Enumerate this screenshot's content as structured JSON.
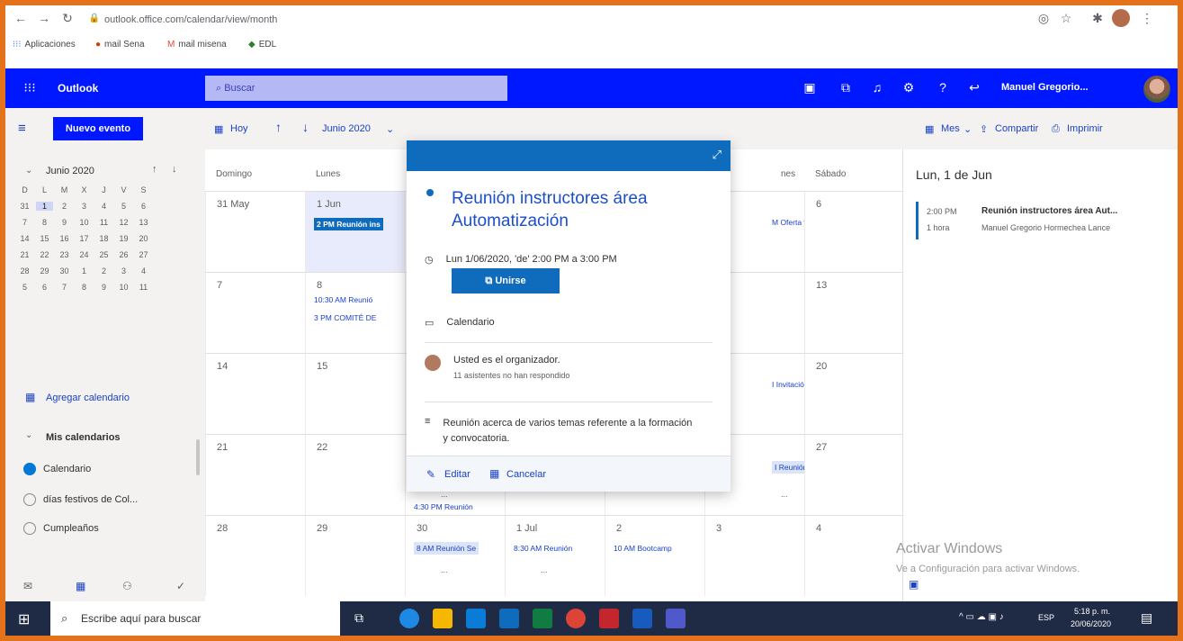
{
  "browser": {
    "url": "outlook.office.com/calendar/view/month",
    "bookmarks": [
      "Aplicaciones",
      "mail Sena",
      "mail misena",
      "EDL"
    ]
  },
  "header": {
    "app_name": "Outlook",
    "search_placeholder": "Buscar",
    "user_name": "Manuel Gregorio..."
  },
  "toolbar": {
    "new_event": "Nuevo evento",
    "today": "Hoy",
    "month_label": "Junio 2020",
    "view": "Mes",
    "share": "Compartir",
    "print": "Imprimir"
  },
  "mini_calendar": {
    "title": "Junio 2020",
    "weekday_headers": [
      "D",
      "L",
      "M",
      "X",
      "J",
      "V",
      "S"
    ],
    "weeks": [
      [
        "31",
        "1",
        "2",
        "3",
        "4",
        "5",
        "6"
      ],
      [
        "7",
        "8",
        "9",
        "10",
        "11",
        "12",
        "13"
      ],
      [
        "14",
        "15",
        "16",
        "17",
        "18",
        "19",
        "20"
      ],
      [
        "21",
        "22",
        "23",
        "24",
        "25",
        "26",
        "27"
      ],
      [
        "28",
        "29",
        "30",
        "1",
        "2",
        "3",
        "4"
      ],
      [
        "5",
        "6",
        "7",
        "8",
        "9",
        "10",
        "11"
      ]
    ],
    "selected": "1"
  },
  "left_nav": {
    "add_calendar": "Agregar calendario",
    "my_calendars": "Mis calendarios",
    "calendars": [
      {
        "name": "Calendario",
        "checked": true
      },
      {
        "name": "días festivos de Col...",
        "checked": false
      },
      {
        "name": "Cumpleaños",
        "checked": false
      }
    ]
  },
  "grid": {
    "day_headers": [
      "Domingo",
      "Lunes",
      "",
      "",
      "",
      "nes",
      "Sábado"
    ],
    "weeks": [
      {
        "days": [
          "31 May",
          "1 Jun",
          "",
          "",
          "",
          "",
          "6"
        ]
      },
      {
        "days": [
          "7",
          "8",
          "",
          "",
          "",
          "",
          "13"
        ]
      },
      {
        "days": [
          "14",
          "15",
          "",
          "",
          "",
          "",
          "20"
        ]
      },
      {
        "days": [
          "21",
          "22",
          "",
          "",
          "",
          "",
          "27"
        ]
      },
      {
        "days": [
          "28",
          "29",
          "30",
          "1 Jul",
          "2",
          "3",
          "4"
        ]
      }
    ],
    "events": {
      "mon1": "2 PM Reunión ins",
      "fri1": "M Oferta y c",
      "mon8a": "10:30 AM Reunió",
      "mon8b": "3 PM COMITÉ DE",
      "fri15": "I Invitació",
      "fri22": "I Reunión",
      "wed24": "4:30 PM Reunión",
      "tue30": "8 AM Reunión Se",
      "wed1": "8:30 AM Reunión",
      "thu2": "10 AM Bootcamp"
    },
    "more": "..."
  },
  "popup": {
    "title": "Reunión instructores área Automatización",
    "datetime": "Lun 1/06/2020, 'de' 2:00 PM a 3:00 PM",
    "join": "Unirse",
    "calendar": "Calendario",
    "organizer": "Usted es el organizador.",
    "attendees": "11 asistentes no han respondido",
    "description": "Reunión acerca de varios temas referente a la formación y convocatoria.",
    "edit": "Editar",
    "cancel": "Cancelar"
  },
  "agenda": {
    "date": "Lun, 1 de Jun",
    "time": "2:00 PM",
    "duration": "1 hora",
    "title": "Reunión instructores área Aut...",
    "organizer": "Manuel Gregorio Hormechea Lance"
  },
  "watermark": {
    "line1": "Activar Windows",
    "line2": "Ve a Configuración para activar Windows."
  },
  "taskbar": {
    "search_placeholder": "Escribe aquí para buscar",
    "time": "5:18 p. m.",
    "date": "20/06/2020",
    "lang": "ESP"
  },
  "colors": {
    "header_blue": "#0018ff",
    "event_blue": "#0f6cbd",
    "frame_orange": "#e4721a"
  }
}
